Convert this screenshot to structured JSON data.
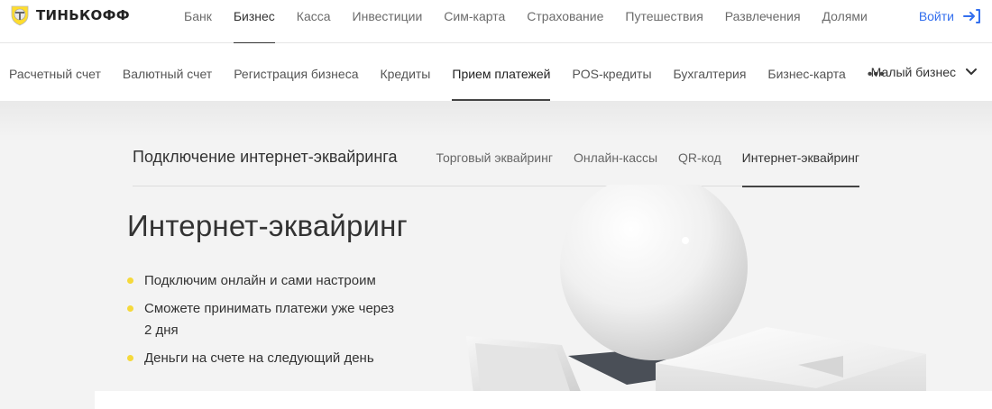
{
  "brand": {
    "name": "ТИНЬКОФФ"
  },
  "topnav": {
    "items": [
      {
        "label": "Банк",
        "active": false
      },
      {
        "label": "Бизнес",
        "active": true
      },
      {
        "label": "Касса",
        "active": false
      },
      {
        "label": "Инвестиции",
        "active": false
      },
      {
        "label": "Сим-карта",
        "active": false
      },
      {
        "label": "Страхование",
        "active": false
      },
      {
        "label": "Путешествия",
        "active": false
      },
      {
        "label": "Развлечения",
        "active": false
      },
      {
        "label": "Долями",
        "active": false
      }
    ],
    "login_label": "Войти",
    "login_icon": "login-arrow-icon"
  },
  "subnav": {
    "items": [
      {
        "label": "Расчетный счет",
        "active": false
      },
      {
        "label": "Валютный счет",
        "active": false
      },
      {
        "label": "Регистрация бизнеса",
        "active": false
      },
      {
        "label": "Кредиты",
        "active": false
      },
      {
        "label": "Прием платежей",
        "active": true
      },
      {
        "label": "POS-кредиты",
        "active": false
      },
      {
        "label": "Бухгалтерия",
        "active": false
      },
      {
        "label": "Бизнес-карта",
        "active": false
      }
    ],
    "more_label": "•••",
    "segment_label": "Малый бизнес"
  },
  "product": {
    "title": "Подключение интернет-эквайринга",
    "tabs": [
      {
        "label": "Торговый эквайринг",
        "active": false
      },
      {
        "label": "Онлайн-кассы",
        "active": false
      },
      {
        "label": "QR-код",
        "active": false
      },
      {
        "label": "Интернет-эквайринг",
        "active": true
      }
    ]
  },
  "hero": {
    "title": "Интернет-эквайринг",
    "bullets": [
      "Подключим онлайн и сами настроим",
      "Сможете принимать платежи уже через 2 дня",
      "Деньги на счете на следующий день"
    ]
  },
  "colors": {
    "accent_yellow": "#f5d93b",
    "link_blue": "#336fee",
    "background_grey": "#f3f3f3"
  }
}
